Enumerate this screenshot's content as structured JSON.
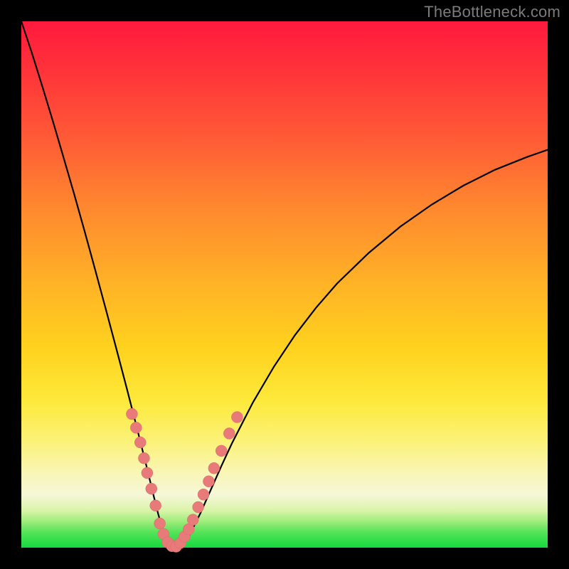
{
  "watermark": "TheBottleneck.com",
  "colors": {
    "frame": "#000000",
    "curve": "#000000",
    "marker_fill": "#e87a7a",
    "marker_stroke": "#d96a6a"
  },
  "chart_data": {
    "type": "line",
    "title": "",
    "xlabel": "",
    "ylabel": "",
    "xlim": [
      0,
      100
    ],
    "ylim": [
      0,
      100
    ],
    "x": [
      0,
      2,
      4,
      6,
      8,
      10,
      12,
      14,
      16,
      18,
      20,
      22,
      23,
      24,
      25,
      26,
      27,
      28,
      29,
      30,
      32,
      34,
      36,
      38,
      40,
      44,
      48,
      52,
      56,
      60,
      66,
      72,
      78,
      84,
      90,
      96,
      100
    ],
    "series": [
      {
        "name": "bottleneck-curve",
        "values": [
          100,
          94.0,
          87.6,
          81.0,
          74.2,
          67.3,
          60.2,
          52.9,
          45.5,
          38.0,
          30.4,
          22.6,
          18.6,
          14.6,
          10.4,
          6.4,
          3.0,
          1.0,
          0.2,
          0.3,
          2.5,
          6.5,
          11.0,
          15.5,
          19.8,
          27.6,
          34.4,
          40.4,
          45.6,
          50.2,
          56.0,
          61.0,
          65.2,
          68.8,
          71.8,
          74.2,
          75.6
        ]
      }
    ],
    "markers": {
      "name": "highlight-dots",
      "points": [
        {
          "x": 21.0,
          "y": 25.4
        },
        {
          "x": 21.8,
          "y": 22.8
        },
        {
          "x": 22.6,
          "y": 20.0
        },
        {
          "x": 23.3,
          "y": 17.0
        },
        {
          "x": 23.9,
          "y": 14.2
        },
        {
          "x": 24.7,
          "y": 11.2
        },
        {
          "x": 25.5,
          "y": 8.0
        },
        {
          "x": 26.3,
          "y": 4.6
        },
        {
          "x": 27.0,
          "y": 2.6
        },
        {
          "x": 27.8,
          "y": 1.0
        },
        {
          "x": 28.6,
          "y": 0.3
        },
        {
          "x": 29.4,
          "y": 0.2
        },
        {
          "x": 30.2,
          "y": 0.9
        },
        {
          "x": 31.0,
          "y": 2.1
        },
        {
          "x": 31.8,
          "y": 3.5
        },
        {
          "x": 32.6,
          "y": 5.3
        },
        {
          "x": 33.6,
          "y": 7.7
        },
        {
          "x": 34.6,
          "y": 10.1
        },
        {
          "x": 35.6,
          "y": 12.6
        },
        {
          "x": 36.6,
          "y": 15.1
        },
        {
          "x": 38.0,
          "y": 18.4
        },
        {
          "x": 39.5,
          "y": 21.7
        },
        {
          "x": 41.0,
          "y": 24.8
        }
      ]
    }
  }
}
